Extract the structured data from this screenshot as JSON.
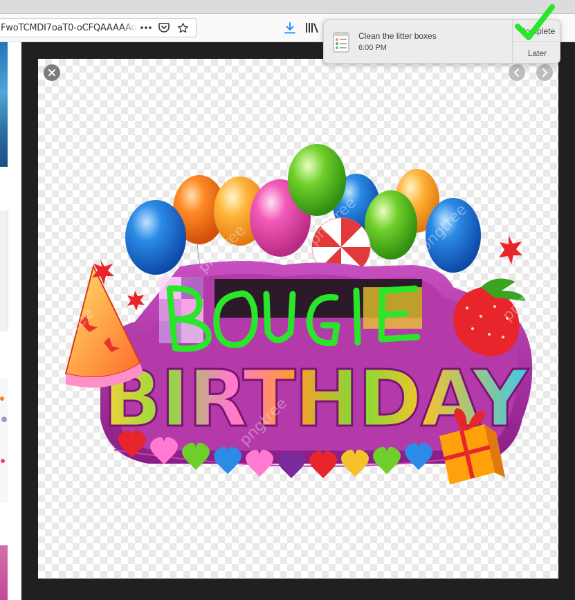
{
  "browser": {
    "url_text": "FwoTCMDI7oaT0-oCFQAAAAAd",
    "page_actions_icon": "ellipsis-icon",
    "pocket_icon": "pocket-icon",
    "bookmark_icon": "star-icon",
    "download_icon": "download-icon",
    "library_icon": "library-icon"
  },
  "viewer": {
    "close_icon": "close-icon",
    "prev_icon": "chevron-left-icon",
    "next_icon": "chevron-right-icon",
    "image": {
      "scribble_text": "BOUGIE",
      "main_text": "BIRTHDAY",
      "watermark": "pngtree"
    }
  },
  "notification": {
    "title": "Clean the litter boxes",
    "time": "6:00 PM",
    "primary_action": "Complete",
    "secondary_action": "Later",
    "icon": "reminders-list-icon"
  },
  "colors": {
    "accent_blue": "#0a84ff",
    "scribble_green": "#29e62a",
    "banner_magenta": "#a8289a",
    "viewer_bg": "#202020"
  }
}
